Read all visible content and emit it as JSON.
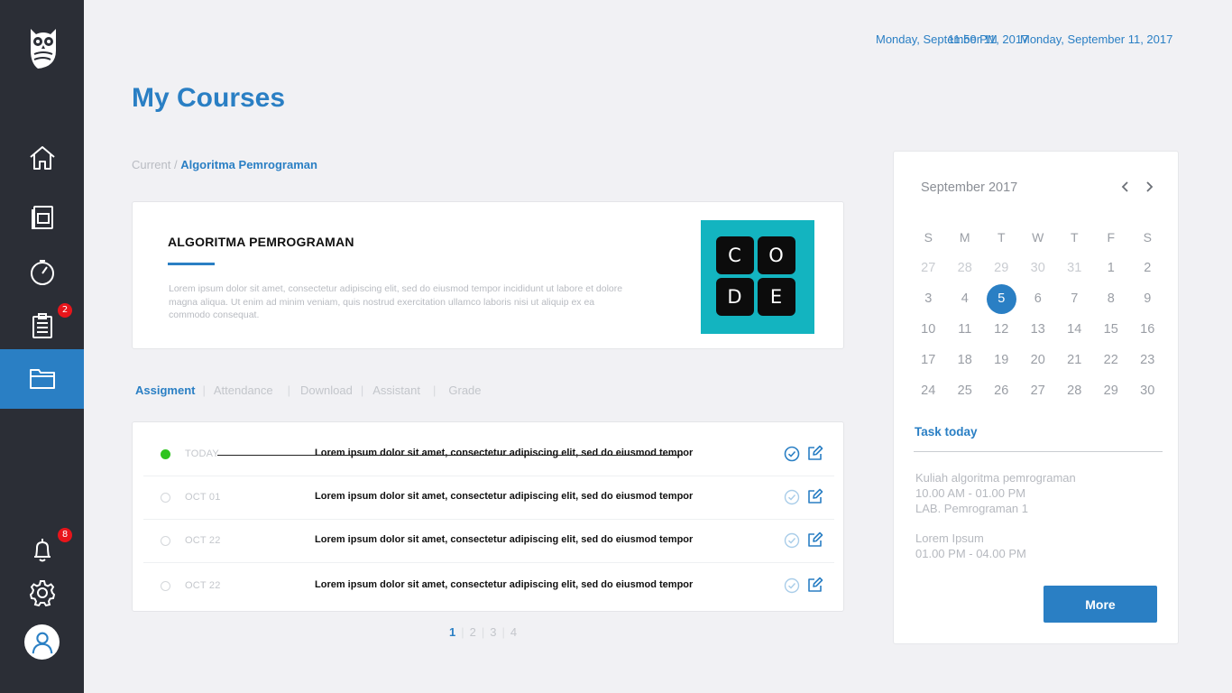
{
  "sidebar": {
    "badges": {
      "tasks": "2",
      "notifications": "8"
    }
  },
  "header": {
    "date_left": "Monday, September 11, 2017",
    "time_overlap": "11:50 PM",
    "date_right": "Monday, September 11, 2017",
    "page_title": "My Courses"
  },
  "breadcrumb": {
    "root": "Current",
    "separator": "/",
    "current": "Algoritma Pemrograman"
  },
  "course": {
    "title": "ALGORITMA PEMROGRAMAN",
    "description": "Lorem ipsum dolor sit amet, consectetur adipiscing elit, sed do eiusmod tempor incididunt ut labore et dolore magna aliqua. Ut enim ad minim veniam, quis nostrud exercitation ullamco laboris nisi ut aliquip ex ea commodo consequat.",
    "logo_letters": [
      "C",
      "O",
      "D",
      "E"
    ],
    "logo_color": "#13b4c0"
  },
  "tabs": [
    "Assigment",
    "Attendance",
    "Download",
    "Assistant",
    "Grade"
  ],
  "assignments": [
    {
      "date": "TODAY",
      "text": "Lorem ipsum dolor sit amet, consectetur adipiscing elit, sed do eiusmod tempor",
      "status": "done"
    },
    {
      "date": "OCT 01",
      "text": "Lorem ipsum dolor sit amet, consectetur adipiscing elit, sed do eiusmod tempor",
      "status": "pending"
    },
    {
      "date": "OCT 22",
      "text": "Lorem ipsum dolor sit amet, consectetur adipiscing elit, sed do eiusmod tempor",
      "status": "pending"
    },
    {
      "date": "OCT 22",
      "text": "Lorem ipsum dolor sit amet, consectetur adipiscing elit, sed do eiusmod tempor",
      "status": "pending"
    }
  ],
  "pagination": {
    "pages": [
      "1",
      "2",
      "3",
      "4"
    ],
    "current": "1"
  },
  "calendar": {
    "month": "September 2017",
    "weekdays": [
      "S",
      "M",
      "T",
      "W",
      "T",
      "F",
      "S"
    ],
    "weeks": [
      [
        "27",
        "28",
        "29",
        "30",
        "31",
        "1",
        "2"
      ],
      [
        "3",
        "4",
        "5",
        "6",
        "7",
        "8",
        "9"
      ],
      [
        "10",
        "11",
        "12",
        "13",
        "14",
        "15",
        "16"
      ],
      [
        "17",
        "18",
        "19",
        "20",
        "21",
        "22",
        "23"
      ],
      [
        "24",
        "25",
        "26",
        "27",
        "28",
        "29",
        "30"
      ]
    ],
    "selected": "5"
  },
  "tasks": {
    "title": "Task today",
    "items": [
      {
        "name": "Kuliah algoritma pemrograman",
        "time": "10.00 AM - 01.00 PM",
        "place": "LAB. Pemrograman 1"
      },
      {
        "name": "Lorem Ipsum",
        "time": "01.00 PM - 04.00 PM"
      }
    ],
    "more_label": "More"
  },
  "colors": {
    "accent": "#2a7fc4",
    "sidebar": "#2b2e36",
    "done": "#2ec41f",
    "badge": "#e8151b"
  }
}
